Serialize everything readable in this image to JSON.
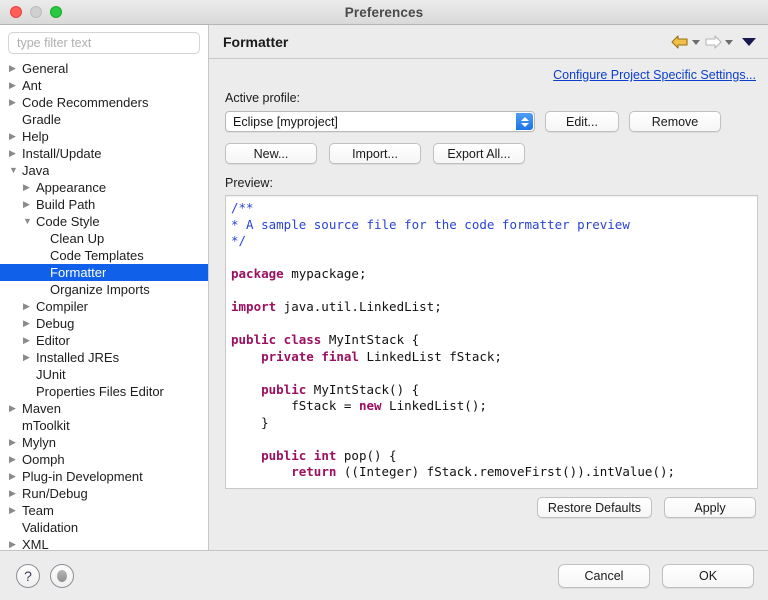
{
  "window": {
    "title": "Preferences",
    "traffic_lights": [
      "close",
      "minimize",
      "maximize"
    ]
  },
  "sidebar": {
    "filter_placeholder": "type filter text",
    "filter_value": "",
    "items": [
      {
        "label": "General",
        "depth": 0,
        "twisty": "collapsed",
        "selected": false
      },
      {
        "label": "Ant",
        "depth": 0,
        "twisty": "collapsed",
        "selected": false
      },
      {
        "label": "Code Recommenders",
        "depth": 0,
        "twisty": "collapsed",
        "selected": false
      },
      {
        "label": "Gradle",
        "depth": 0,
        "twisty": "none",
        "selected": false
      },
      {
        "label": "Help",
        "depth": 0,
        "twisty": "collapsed",
        "selected": false
      },
      {
        "label": "Install/Update",
        "depth": 0,
        "twisty": "collapsed",
        "selected": false
      },
      {
        "label": "Java",
        "depth": 0,
        "twisty": "expanded",
        "selected": false
      },
      {
        "label": "Appearance",
        "depth": 1,
        "twisty": "collapsed",
        "selected": false
      },
      {
        "label": "Build Path",
        "depth": 1,
        "twisty": "collapsed",
        "selected": false
      },
      {
        "label": "Code Style",
        "depth": 1,
        "twisty": "expanded",
        "selected": false
      },
      {
        "label": "Clean Up",
        "depth": 2,
        "twisty": "none",
        "selected": false
      },
      {
        "label": "Code Templates",
        "depth": 2,
        "twisty": "none",
        "selected": false
      },
      {
        "label": "Formatter",
        "depth": 2,
        "twisty": "none",
        "selected": true
      },
      {
        "label": "Organize Imports",
        "depth": 2,
        "twisty": "none",
        "selected": false
      },
      {
        "label": "Compiler",
        "depth": 1,
        "twisty": "collapsed",
        "selected": false
      },
      {
        "label": "Debug",
        "depth": 1,
        "twisty": "collapsed",
        "selected": false
      },
      {
        "label": "Editor",
        "depth": 1,
        "twisty": "collapsed",
        "selected": false
      },
      {
        "label": "Installed JREs",
        "depth": 1,
        "twisty": "collapsed",
        "selected": false
      },
      {
        "label": "JUnit",
        "depth": 1,
        "twisty": "none",
        "selected": false
      },
      {
        "label": "Properties Files Editor",
        "depth": 1,
        "twisty": "none",
        "selected": false
      },
      {
        "label": "Maven",
        "depth": 0,
        "twisty": "collapsed",
        "selected": false
      },
      {
        "label": "mToolkit",
        "depth": 0,
        "twisty": "none",
        "selected": false
      },
      {
        "label": "Mylyn",
        "depth": 0,
        "twisty": "collapsed",
        "selected": false
      },
      {
        "label": "Oomph",
        "depth": 0,
        "twisty": "collapsed",
        "selected": false
      },
      {
        "label": "Plug-in Development",
        "depth": 0,
        "twisty": "collapsed",
        "selected": false
      },
      {
        "label": "Run/Debug",
        "depth": 0,
        "twisty": "collapsed",
        "selected": false
      },
      {
        "label": "Team",
        "depth": 0,
        "twisty": "collapsed",
        "selected": false
      },
      {
        "label": "Validation",
        "depth": 0,
        "twisty": "none",
        "selected": false
      },
      {
        "label": "XML",
        "depth": 0,
        "twisty": "collapsed",
        "selected": false
      }
    ]
  },
  "page": {
    "title": "Formatter",
    "nav": {
      "back_icon": "back-arrow-icon",
      "forward_icon": "forward-arrow-icon",
      "menu_icon": "view-menu-icon"
    },
    "project_settings_link": "Configure Project Specific Settings...",
    "active_profile_label": "Active profile:",
    "active_profile_value": "Eclipse [myproject]",
    "edit_button": "Edit...",
    "remove_button": "Remove",
    "new_button": "New...",
    "import_button": "Import...",
    "export_all_button": "Export All...",
    "preview_label": "Preview:",
    "restore_defaults_button": "Restore Defaults",
    "apply_button": "Apply"
  },
  "preview_code": {
    "lines": [
      {
        "segments": [
          {
            "t": "/**",
            "c": "cm"
          }
        ]
      },
      {
        "segments": [
          {
            "t": "* A sample source file for the code formatter preview",
            "c": "cm"
          }
        ]
      },
      {
        "segments": [
          {
            "t": "*/",
            "c": "cm"
          }
        ]
      },
      {
        "segments": [
          {
            "t": "",
            "c": ""
          }
        ]
      },
      {
        "segments": [
          {
            "t": "package",
            "c": "kw"
          },
          {
            "t": " mypackage;",
            "c": ""
          }
        ]
      },
      {
        "segments": [
          {
            "t": "",
            "c": ""
          }
        ]
      },
      {
        "segments": [
          {
            "t": "import",
            "c": "kw"
          },
          {
            "t": " java.util.LinkedList;",
            "c": ""
          }
        ]
      },
      {
        "segments": [
          {
            "t": "",
            "c": ""
          }
        ]
      },
      {
        "segments": [
          {
            "t": "public class",
            "c": "kw"
          },
          {
            "t": " MyIntStack {",
            "c": ""
          }
        ]
      },
      {
        "segments": [
          {
            "t": "    ",
            "c": ""
          },
          {
            "t": "private final",
            "c": "kw"
          },
          {
            "t": " LinkedList fStack;",
            "c": ""
          }
        ]
      },
      {
        "segments": [
          {
            "t": "",
            "c": ""
          }
        ]
      },
      {
        "segments": [
          {
            "t": "    ",
            "c": ""
          },
          {
            "t": "public",
            "c": "kw"
          },
          {
            "t": " MyIntStack() {",
            "c": ""
          }
        ]
      },
      {
        "segments": [
          {
            "t": "        fStack = ",
            "c": ""
          },
          {
            "t": "new",
            "c": "kw"
          },
          {
            "t": " LinkedList();",
            "c": ""
          }
        ]
      },
      {
        "segments": [
          {
            "t": "    }",
            "c": ""
          }
        ]
      },
      {
        "segments": [
          {
            "t": "",
            "c": ""
          }
        ]
      },
      {
        "segments": [
          {
            "t": "    ",
            "c": ""
          },
          {
            "t": "public int",
            "c": "kw"
          },
          {
            "t": " pop() {",
            "c": ""
          }
        ]
      },
      {
        "segments": [
          {
            "t": "        ",
            "c": ""
          },
          {
            "t": "return",
            "c": "kw"
          },
          {
            "t": " ((Integer) fStack.removeFirst()).intValue();",
            "c": ""
          }
        ]
      }
    ]
  },
  "footer": {
    "help_icon": "help-question-icon",
    "secondary_icon": "toggle-circle-icon",
    "cancel_button": "Cancel",
    "ok_button": "OK"
  },
  "colors": {
    "selection_blue": "#1060ea",
    "link_blue": "#0d3ecf",
    "comment_blue": "#2a43d4",
    "keyword_magenta": "#9b1060",
    "combo_button_blue": "#1a74e8",
    "back_arrow_gold": "#e8b84b"
  }
}
